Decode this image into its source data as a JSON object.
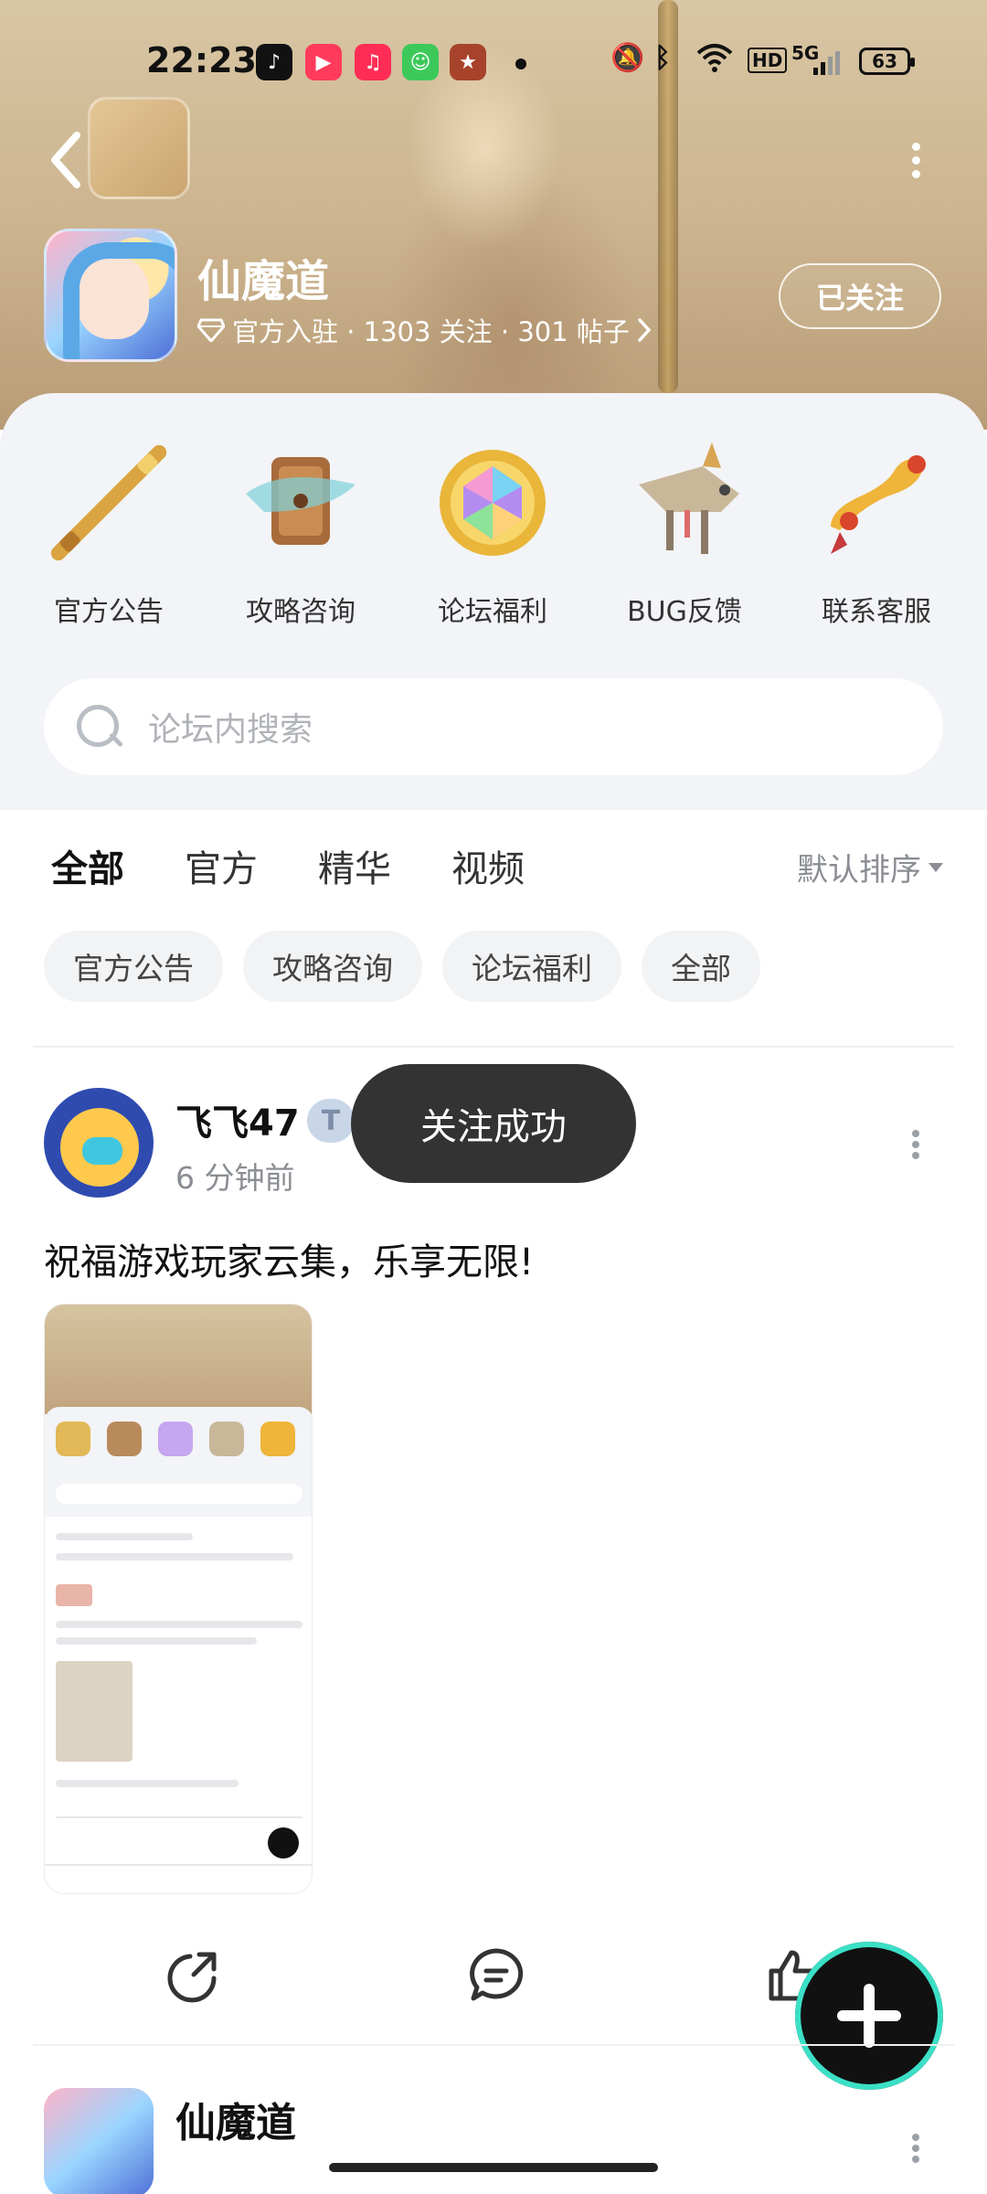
{
  "status_bar": {
    "time": "22:23",
    "network": "5G",
    "hd_label": "HD",
    "battery": "63"
  },
  "header": {
    "game_name": "仙魔道",
    "meta": "官方入驻 · 1303 关注 · 301 帖子",
    "follow_label": "已关注"
  },
  "entries": [
    {
      "label": "官方公告",
      "icon": "golden-staff-icon"
    },
    {
      "label": "攻略咨询",
      "icon": "scroll-icon"
    },
    {
      "label": "论坛福利",
      "icon": "rainbow-gem-icon"
    },
    {
      "label": "BUG反馈",
      "icon": "mech-beast-icon"
    },
    {
      "label": "联系客服",
      "icon": "ruyi-scepter-icon"
    }
  ],
  "search": {
    "placeholder": "论坛内搜索"
  },
  "tabs": [
    {
      "label": "全部",
      "active": true
    },
    {
      "label": "官方"
    },
    {
      "label": "精华"
    },
    {
      "label": "视频"
    }
  ],
  "sort_label": "默认排序",
  "chips": [
    "官方公告",
    "攻略咨询",
    "论坛福利",
    "全部"
  ],
  "post": {
    "author": "飞飞47",
    "time": "6 分钟前",
    "text": "祝福游戏玩家云集，乐享无限!"
  },
  "next_post": {
    "author": "仙魔道"
  },
  "toast": "关注成功",
  "colors": {
    "accent": "#38d1c4",
    "toast_bg": "#333333",
    "panel_bg": "#f2f4f7"
  }
}
